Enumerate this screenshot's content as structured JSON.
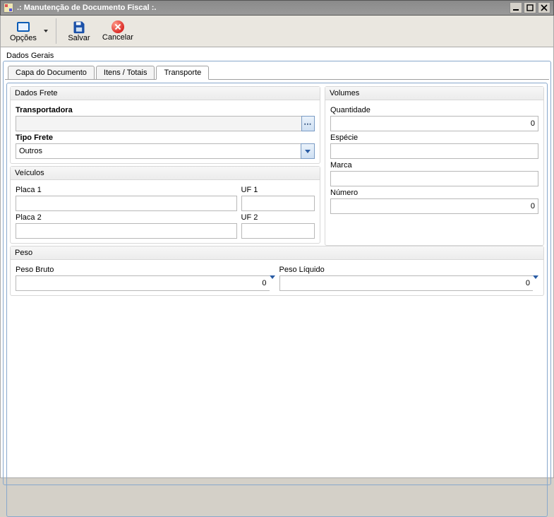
{
  "window": {
    "title": ".: Manutenção de Documento Fiscal :."
  },
  "toolbar": {
    "options_label": "Opções",
    "save_label": "Salvar",
    "cancel_label": "Cancelar"
  },
  "group": {
    "title": "Dados Gerais"
  },
  "tabs": {
    "capa": "Capa do Documento",
    "itens": "Itens / Totais",
    "transporte": "Transporte"
  },
  "frete": {
    "title": "Dados Frete",
    "transportadora_label": "Transportadora",
    "transportadora_value": "",
    "tipo_frete_label": "Tipo Frete",
    "tipo_frete_value": "Outros"
  },
  "veiculos": {
    "title": "Veículos",
    "placa1_label": "Placa 1",
    "uf1_label": "UF 1",
    "placa1_value": "",
    "uf1_value": "",
    "placa2_label": "Placa 2",
    "uf2_label": "UF 2",
    "placa2_value": "",
    "uf2_value": ""
  },
  "volumes": {
    "title": "Volumes",
    "quantidade_label": "Quantidade",
    "quantidade_value": "0",
    "especie_label": "Espécie",
    "especie_value": "",
    "marca_label": "Marca",
    "marca_value": "",
    "numero_label": "Número",
    "numero_value": "0"
  },
  "peso": {
    "title": "Peso",
    "bruto_label": "Peso Bruto",
    "bruto_value": "0",
    "liquido_label": "Peso Líquido",
    "liquido_value": "0"
  }
}
